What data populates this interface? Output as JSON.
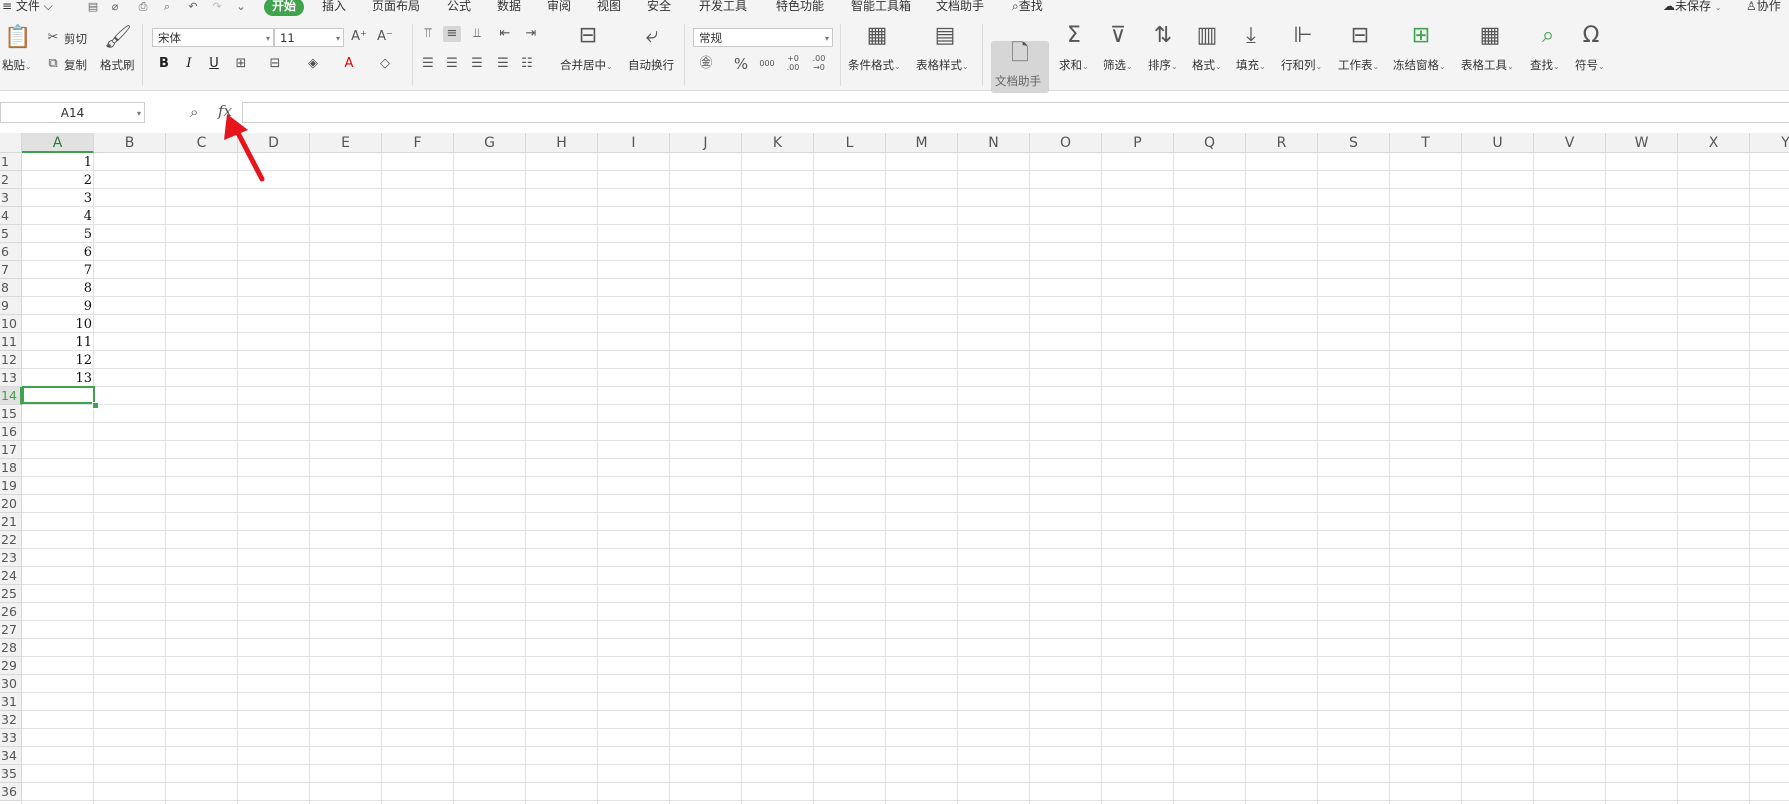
{
  "menubar": {
    "items": [
      "≡ 文件 ⌵",
      "开始",
      "插入",
      "页面布局",
      "公式",
      "数据",
      "审阅",
      "视图",
      "安全",
      "开发工具",
      "特色功能",
      "智能工具箱",
      "文档助手",
      "查找"
    ],
    "unsaved": "未保存",
    "collab": "协作"
  },
  "ribbon": {
    "paste": "粘贴",
    "cut": "剪切",
    "copy": "复制",
    "format_painter": "格式刷",
    "font_name": "宋体",
    "font_size": "11",
    "bold": "B",
    "italic": "I",
    "underline": "U",
    "merge_center": "合并居中",
    "wrap_text": "自动换行",
    "number_format": "常规",
    "percent": "%",
    "thousands": "000",
    "dec_inc": "+0 .00",
    "dec_dec": ".00 →0",
    "conditional_format": "条件格式",
    "table_style": "表格样式",
    "doc_assistant": "文档助手",
    "sum": "求和",
    "filter": "筛选",
    "sort": "排序",
    "format": "格式",
    "fill": "填充",
    "rows_cols": "行和列",
    "worksheet": "工作表",
    "freeze_panes": "冻结窗格",
    "table_tools": "表格工具",
    "find": "查找",
    "symbol": "符号"
  },
  "formula_bar": {
    "name_box": "A14",
    "fx": "fx",
    "value": ""
  },
  "sheet": {
    "columns": [
      "A",
      "B",
      "C",
      "D",
      "E",
      "F",
      "G",
      "H",
      "I",
      "J",
      "K",
      "L",
      "M",
      "N",
      "O",
      "P",
      "Q",
      "R",
      "S",
      "T",
      "U",
      "V",
      "W",
      "X",
      "Y"
    ],
    "rows": [
      "1",
      "2",
      "3",
      "4",
      "5",
      "6",
      "7",
      "8",
      "9",
      "10",
      "11",
      "12",
      "13",
      "14",
      "15",
      "16",
      "17",
      "18",
      "19",
      "20",
      "21",
      "22",
      "23",
      "24",
      "25",
      "26",
      "27",
      "28",
      "29",
      "30",
      "31",
      "32",
      "33",
      "34",
      "35",
      "36"
    ],
    "column_a_values": [
      "1",
      "2",
      "3",
      "4",
      "5",
      "6",
      "7",
      "8",
      "9",
      "10",
      "11",
      "12",
      "13"
    ],
    "active_cell": "A14",
    "selected_column": "A",
    "selected_row": "14"
  },
  "colors": {
    "accent": "#3fa34d",
    "arrow": "#e8141c",
    "gridline": "#e2e2e2"
  }
}
